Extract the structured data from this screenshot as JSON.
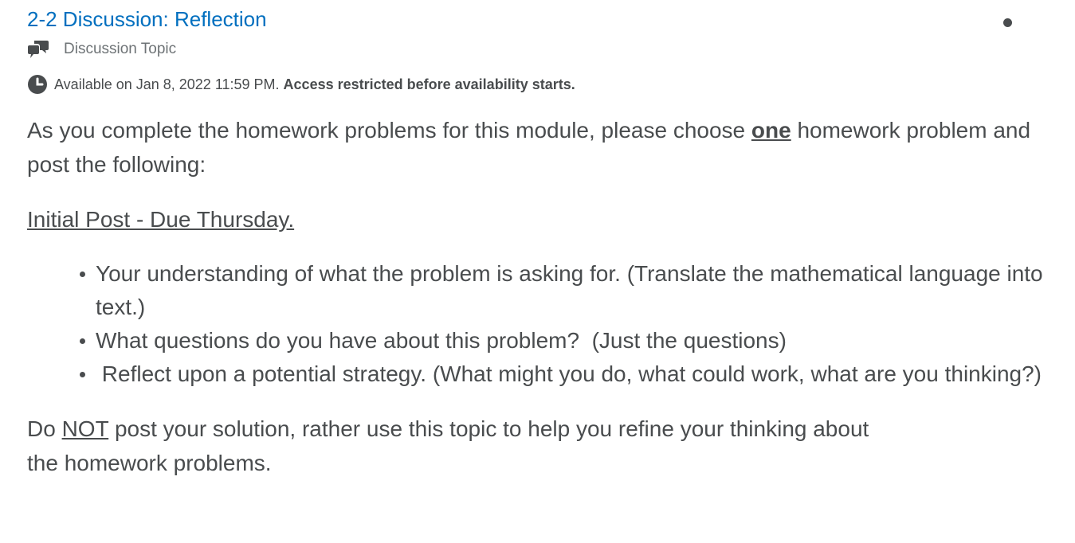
{
  "header": {
    "title": "2-2 Discussion: Reflection",
    "more_icon": "dot-menu-icon",
    "type_icon": "discussion-icon",
    "type_label": "Discussion Topic",
    "availability_icon": "clock-icon",
    "availability_text": "Available on Jan 8, 2022 11:59 PM.",
    "availability_note": "Access restricted before availability starts."
  },
  "body": {
    "intro_before": "As you complete the homework problems for this module, please choose ",
    "intro_emphasis": "one",
    "intro_after": " homework problem and post the following:",
    "initial_post": "Initial Post - Due Thursday.",
    "bullets": [
      "Your understanding of what the problem is asking for. (Translate the mathematical language into text.)",
      "What questions do you have about this problem?  (Just the questions)",
      " Reflect upon a potential strategy. (What might you do, what could work, what are you thinking?)"
    ],
    "closing_before": "Do ",
    "closing_emphasis": "NOT",
    "closing_after": " post your solution, rather use this topic to help you refine your thinking about",
    "closing_line2": "the homework problems."
  },
  "colors": {
    "link": "#006fbf",
    "text": "#494c4e",
    "muted": "#6e7376"
  }
}
